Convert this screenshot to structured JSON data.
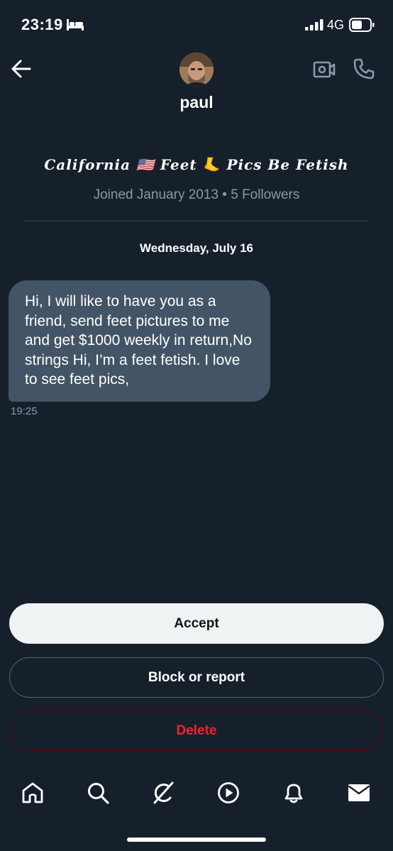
{
  "status_bar": {
    "time": "23:19",
    "network": "4G",
    "sleep_icon": "bed-icon",
    "signal_icon": "signal-bars-icon",
    "battery_icon": "battery-icon"
  },
  "header": {
    "back_icon": "arrow-left-icon",
    "user_name": "paul",
    "video_icon": "video-camera-icon",
    "phone_icon": "phone-icon"
  },
  "profile": {
    "bio": "California 🇺🇸 Feet 🦶 Pics Be Fetish",
    "meta": "Joined January 2013 • 5 Followers"
  },
  "conversation": {
    "date": "Wednesday, July 16",
    "messages": [
      {
        "text": "Hi, I will like to have you as a friend, send feet pictures to me and get $1000 weekly in return,No strings Hi, I’m a feet fetish. I love to see feet pics,",
        "time": "19:25"
      }
    ]
  },
  "actions": {
    "accept": "Accept",
    "block_report": "Block or report",
    "delete": "Delete"
  },
  "colors": {
    "background": "#15202b",
    "bubble": "#435466",
    "muted": "#8b98a5",
    "delete": "#f4212e"
  },
  "bottom_nav": [
    "home-icon",
    "search-icon",
    "grok-icon",
    "video-play-icon",
    "bell-icon",
    "mail-icon"
  ]
}
